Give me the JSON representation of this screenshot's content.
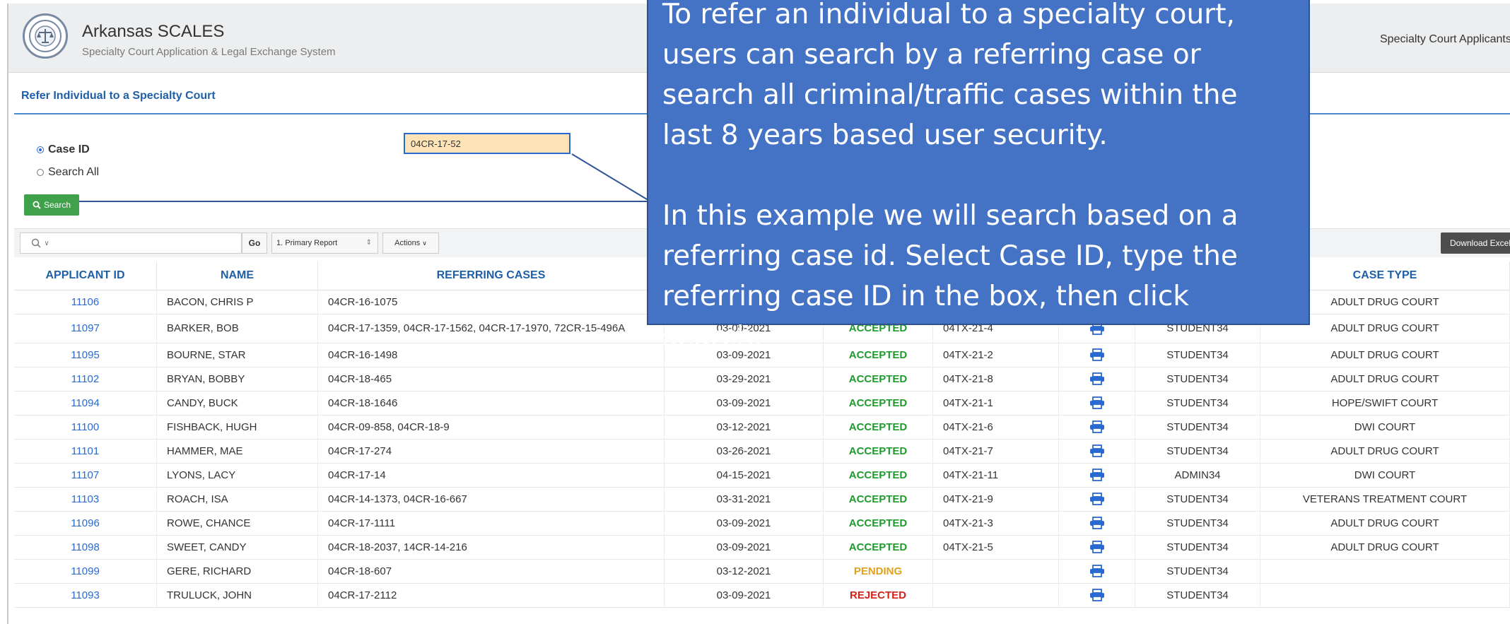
{
  "header": {
    "app_title": "Arkansas SCALES",
    "app_subtitle": "Specialty Court Application & Legal Exchange System",
    "nav_item": "Specialty Court Applicants"
  },
  "form": {
    "panel_title": "Refer Individual to a Specialty Court",
    "radio_case_id": "Case ID",
    "radio_search_all": "Search All",
    "selected_option": "Case ID",
    "case_id_value": "04CR-17-52",
    "search_button": "Search"
  },
  "toolbar": {
    "search_icon_label": "Q∨",
    "go_label": "Go",
    "report_select": "1. Primary Report",
    "actions_label": "Actions",
    "download_label": "Download Excel"
  },
  "table": {
    "columns": {
      "applicant_id": "APPLICANT ID",
      "name": "NAME",
      "referring_cases": "REFERRING CASES",
      "case_type": "CASE TYPE"
    },
    "rows": [
      {
        "id": "11106",
        "name": "BACON, CHRIS P",
        "cases": "04CR-16-1075",
        "date": "",
        "status": "",
        "status_kind": "",
        "case_no": "",
        "user": "",
        "case_type": "ADULT DRUG COURT"
      },
      {
        "id": "11097",
        "name": "BARKER, BOB",
        "cases": "04CR-17-1359, 04CR-17-1562, 04CR-17-1970, 72CR-15-496A",
        "date": "03-09-2021",
        "status": "ACCEPTED",
        "status_kind": "accepted",
        "case_no": "04TX-21-4",
        "user": "STUDENT34",
        "case_type": "ADULT DRUG COURT"
      },
      {
        "id": "11095",
        "name": "BOURNE, STAR",
        "cases": "04CR-16-1498",
        "date": "03-09-2021",
        "status": "ACCEPTED",
        "status_kind": "accepted",
        "case_no": "04TX-21-2",
        "user": "STUDENT34",
        "case_type": "ADULT DRUG COURT"
      },
      {
        "id": "11102",
        "name": "BRYAN, BOBBY",
        "cases": "04CR-18-465",
        "date": "03-29-2021",
        "status": "ACCEPTED",
        "status_kind": "accepted",
        "case_no": "04TX-21-8",
        "user": "STUDENT34",
        "case_type": "ADULT DRUG COURT"
      },
      {
        "id": "11094",
        "name": "CANDY, BUCK",
        "cases": "04CR-18-1646",
        "date": "03-09-2021",
        "status": "ACCEPTED",
        "status_kind": "accepted",
        "case_no": "04TX-21-1",
        "user": "STUDENT34",
        "case_type": "HOPE/SWIFT COURT"
      },
      {
        "id": "11100",
        "name": "FISHBACK, HUGH",
        "cases": "04CR-09-858, 04CR-18-9",
        "date": "03-12-2021",
        "status": "ACCEPTED",
        "status_kind": "accepted",
        "case_no": "04TX-21-6",
        "user": "STUDENT34",
        "case_type": "DWI COURT"
      },
      {
        "id": "11101",
        "name": "HAMMER, MAE",
        "cases": "04CR-17-274",
        "date": "03-26-2021",
        "status": "ACCEPTED",
        "status_kind": "accepted",
        "case_no": "04TX-21-7",
        "user": "STUDENT34",
        "case_type": "ADULT DRUG COURT"
      },
      {
        "id": "11107",
        "name": "LYONS, LACY",
        "cases": "04CR-17-14",
        "date": "04-15-2021",
        "status": "ACCEPTED",
        "status_kind": "accepted",
        "case_no": "04TX-21-11",
        "user": "ADMIN34",
        "case_type": "DWI COURT"
      },
      {
        "id": "11103",
        "name": "ROACH, ISA",
        "cases": "04CR-14-1373, 04CR-16-667",
        "date": "03-31-2021",
        "status": "ACCEPTED",
        "status_kind": "accepted",
        "case_no": "04TX-21-9",
        "user": "STUDENT34",
        "case_type": "VETERANS TREATMENT COURT"
      },
      {
        "id": "11096",
        "name": "ROWE, CHANCE",
        "cases": "04CR-17-1111",
        "date": "03-09-2021",
        "status": "ACCEPTED",
        "status_kind": "accepted",
        "case_no": "04TX-21-3",
        "user": "STUDENT34",
        "case_type": "ADULT DRUG COURT"
      },
      {
        "id": "11098",
        "name": "SWEET, CANDY",
        "cases": "04CR-18-2037, 14CR-14-216",
        "date": "03-09-2021",
        "status": "ACCEPTED",
        "status_kind": "accepted",
        "case_no": "04TX-21-5",
        "user": "STUDENT34",
        "case_type": "ADULT DRUG COURT"
      },
      {
        "id": "11099",
        "name": "GERE, RICHARD",
        "cases": "04CR-18-607",
        "date": "03-12-2021",
        "status": "PENDING",
        "status_kind": "pending",
        "case_no": "",
        "user": "STUDENT34",
        "case_type": ""
      },
      {
        "id": "11093",
        "name": "TRULUCK, JOHN",
        "cases": "04CR-17-2112",
        "date": "03-09-2021",
        "status": "REJECTED",
        "status_kind": "rejected",
        "case_no": "",
        "user": "STUDENT34",
        "case_type": ""
      }
    ]
  },
  "callout": {
    "paragraph_1": "To refer an individual to a specialty court, users can search by a referring case or search all criminal/traffic cases within the last 8 years based user security.",
    "paragraph_2": "In this example we will search based on a referring case id. Select Case ID, type the referring case ID in the box, then click search."
  },
  "colors": {
    "link_blue": "#2a6ad0",
    "header_blue": "#1f5fa7",
    "accepted": "#1e9b2e",
    "pending": "#e0a21c",
    "rejected": "#d0231b",
    "search_button": "#3fa14a",
    "callout_bg": "#4472c4",
    "input_highlight": "#fde3b5"
  },
  "icons": [
    "logo-seal-icon",
    "search-icon",
    "printer-icon",
    "chevron-down-icon",
    "sort-arrows-icon"
  ]
}
